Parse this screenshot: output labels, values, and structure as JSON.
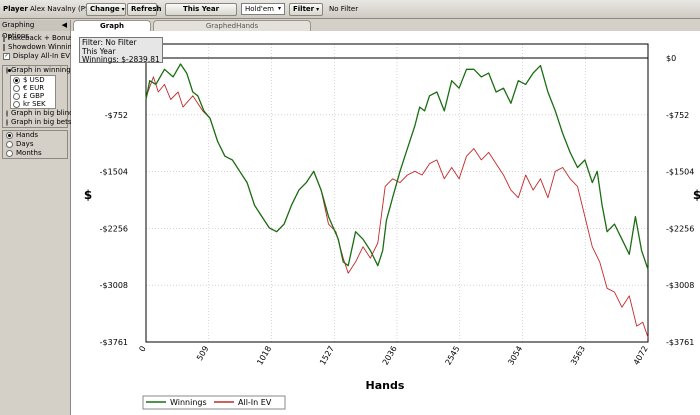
{
  "toolbar": {
    "player_label": "Player",
    "player_name": "Alex Navalny (PS)",
    "change_label": "Change",
    "refresh_label": "Refresh",
    "period_label": "This Year",
    "game_value": "Hold'em",
    "filter_label": "Filter",
    "filter_status": "No Filter"
  },
  "tabs": [
    {
      "label": "Graph",
      "active": true
    },
    {
      "label": "GraphedHands",
      "active": false
    }
  ],
  "sidebar": {
    "title": "Graphing Options",
    "checks": [
      {
        "label": "Rakeback + Bonuses",
        "checked": false
      },
      {
        "label": "Showdown Winnings",
        "checked": false
      },
      {
        "label": "Display All-In EV",
        "checked": true
      }
    ],
    "graph_in_winnings": "Graph in winnings",
    "currencies": [
      {
        "label": "$ USD",
        "selected": true
      },
      {
        "label": "€ EUR",
        "selected": false
      },
      {
        "label": "£ GBP",
        "selected": false
      },
      {
        "label": "kr SEK",
        "selected": false
      }
    ],
    "graph_in_big_blinds": "Graph in big blinds",
    "graph_in_big_bets": "Graph in big bets",
    "x_axis_options": [
      {
        "label": "Hands",
        "selected": true
      },
      {
        "label": "Days",
        "selected": false
      },
      {
        "label": "Months",
        "selected": false
      }
    ]
  },
  "info": {
    "line1": "Filter: No Filter",
    "line2": "This Year",
    "line3": "Winnings: $-2839.81"
  },
  "colors": {
    "winnings": "#1a6e12",
    "allin": "#c42a2a"
  },
  "chart_data": {
    "type": "line",
    "xlabel": "Hands",
    "ylabel": "$",
    "xlim": [
      0,
      4072
    ],
    "ylim": [
      -3761,
      0
    ],
    "x_ticks": [
      "0",
      "509",
      "1018",
      "1527",
      "2036",
      "2545",
      "3054",
      "3563",
      "4072"
    ],
    "y_ticks": [
      "$0",
      "-$752",
      "-$1504",
      "-$2256",
      "-$3008",
      "-$3761"
    ],
    "grid": true,
    "legend": "bottom-left",
    "series": [
      {
        "name": "Winnings",
        "x": [
          0,
          30,
          80,
          150,
          220,
          280,
          330,
          380,
          420,
          470,
          520,
          580,
          640,
          700,
          760,
          820,
          880,
          940,
          1000,
          1060,
          1120,
          1180,
          1240,
          1300,
          1360,
          1420,
          1480,
          1520,
          1560,
          1600,
          1640,
          1700,
          1760,
          1820,
          1880,
          1920,
          1950,
          2000,
          2060,
          2120,
          2180,
          2220,
          2260,
          2300,
          2360,
          2420,
          2480,
          2540,
          2600,
          2660,
          2720,
          2780,
          2840,
          2900,
          2960,
          3020,
          3080,
          3140,
          3200,
          3260,
          3320,
          3380,
          3440,
          3500,
          3560,
          3620,
          3660,
          3700,
          3740,
          3800,
          3860,
          3920,
          3970,
          4020,
          4072
        ],
        "y": [
          -550,
          -300,
          -350,
          -150,
          -250,
          -80,
          -200,
          -450,
          -500,
          -700,
          -800,
          -1100,
          -1300,
          -1350,
          -1500,
          -1650,
          -1950,
          -2100,
          -2250,
          -2300,
          -2200,
          -1950,
          -1750,
          -1650,
          -1500,
          -1750,
          -2100,
          -2250,
          -2400,
          -2700,
          -2750,
          -2300,
          -2400,
          -2550,
          -2750,
          -2550,
          -2150,
          -1850,
          -1500,
          -1200,
          -900,
          -650,
          -700,
          -500,
          -450,
          -700,
          -300,
          -400,
          -150,
          -150,
          -250,
          -200,
          -450,
          -400,
          -600,
          -300,
          -350,
          -200,
          -100,
          -450,
          -700,
          -1000,
          -1250,
          -1450,
          -1350,
          -1650,
          -1500,
          -1950,
          -2300,
          -2200,
          -2400,
          -2600,
          -2100,
          -2550,
          -2800
        ]
      },
      {
        "name": "All-In EV",
        "x": [
          0,
          60,
          100,
          150,
          200,
          260,
          300,
          380,
          460,
          520,
          580,
          640,
          700,
          760,
          820,
          880,
          940,
          1000,
          1060,
          1120,
          1180,
          1240,
          1300,
          1360,
          1420,
          1480,
          1540,
          1600,
          1640,
          1700,
          1760,
          1820,
          1880,
          1940,
          2000,
          2060,
          2120,
          2180,
          2240,
          2300,
          2360,
          2420,
          2480,
          2540,
          2600,
          2660,
          2720,
          2780,
          2840,
          2900,
          2960,
          3020,
          3080,
          3140,
          3200,
          3260,
          3320,
          3380,
          3440,
          3500,
          3560,
          3620,
          3680,
          3740,
          3800,
          3860,
          3920,
          3980,
          4030,
          4072
        ],
        "y": [
          -520,
          -250,
          -450,
          -350,
          -550,
          -450,
          -650,
          -500,
          -700,
          -800,
          -1100,
          -1300,
          -1350,
          -1500,
          -1650,
          -1950,
          -2100,
          -2250,
          -2300,
          -2200,
          -1950,
          -1750,
          -1650,
          -1500,
          -1750,
          -2200,
          -2300,
          -2650,
          -2850,
          -2700,
          -2500,
          -2650,
          -2450,
          -1700,
          -1600,
          -1650,
          -1550,
          -1500,
          -1550,
          -1400,
          -1350,
          -1600,
          -1450,
          -1600,
          -1300,
          -1200,
          -1350,
          -1250,
          -1400,
          -1550,
          -1750,
          -1850,
          -1550,
          -1750,
          -1600,
          -1850,
          -1500,
          -1450,
          -1600,
          -1700,
          -2100,
          -2500,
          -2700,
          -3050,
          -3100,
          -3300,
          -3150,
          -3550,
          -3500,
          -3700
        ]
      }
    ]
  }
}
